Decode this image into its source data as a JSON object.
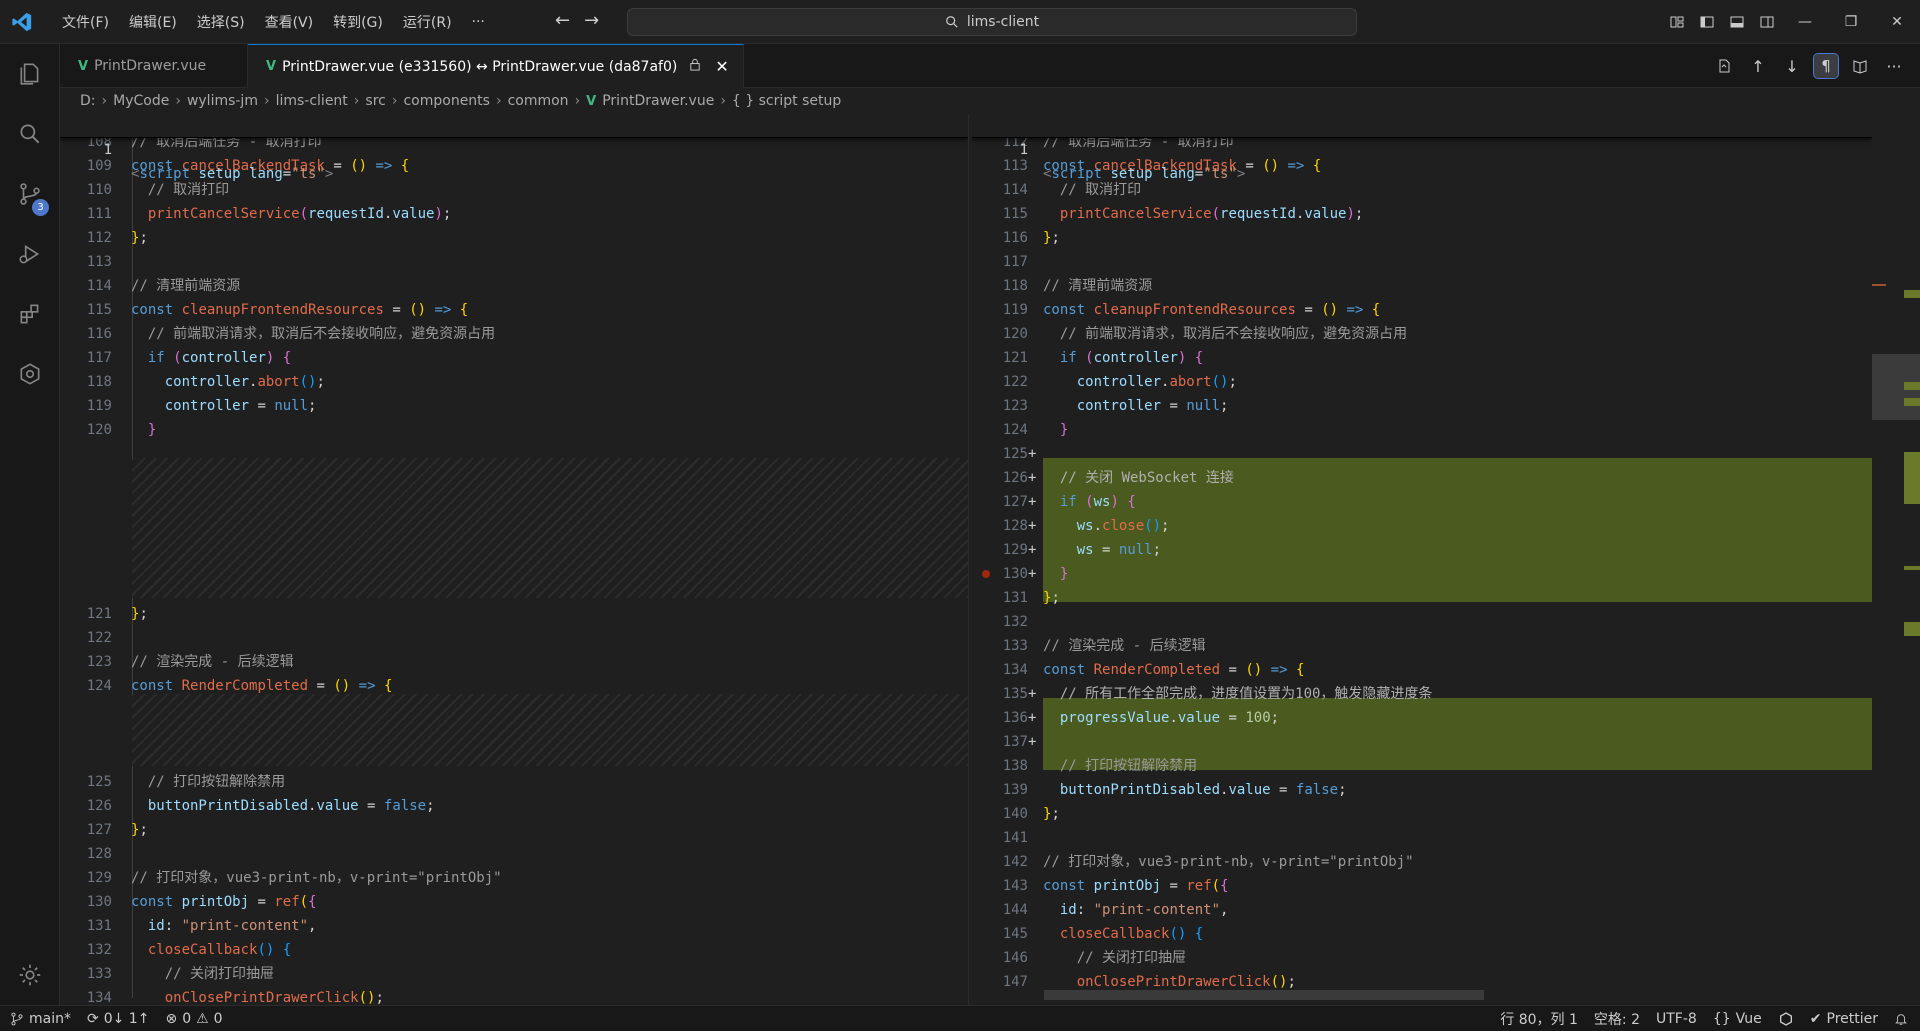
{
  "titlebar": {
    "menu": [
      "文件(F)",
      "编辑(E)",
      "选择(S)",
      "查看(V)",
      "转到(G)",
      "运行(R)",
      "···"
    ],
    "search": "lims-client"
  },
  "activity": {
    "scm_badge": "3"
  },
  "tabs": [
    {
      "label": "PrintDrawer.vue"
    },
    {
      "label": "PrintDrawer.vue (e331560) ↔ PrintDrawer.vue (da87af0)"
    }
  ],
  "breadcrumb": [
    "D:",
    "MyCode",
    "wylims-jm",
    "lims-client",
    "src",
    "components",
    "common",
    "PrintDrawer.vue",
    "{ } script setup"
  ],
  "editor": {
    "sticky_line": "<script setup lang=\"ts\">",
    "sticky_ln": "1",
    "left_numbers": [
      "108",
      "109",
      "110",
      "111",
      "112",
      "113",
      "114",
      "115",
      "116",
      "117",
      "118",
      "119",
      "120",
      "121",
      "122",
      "123",
      "124",
      "125",
      "126",
      "127",
      "128",
      "129",
      "130",
      "131",
      "132",
      "133",
      "134"
    ],
    "right_numbers": [
      "112",
      "113",
      "114",
      "115",
      "116",
      "117",
      "118",
      "119",
      "120",
      "121",
      "122",
      "123",
      "124",
      "125",
      "126",
      "127",
      "128",
      "129",
      "130",
      "131",
      "132",
      "133",
      "134",
      "135",
      "136",
      "137",
      "138",
      "139",
      "140",
      "141",
      "142",
      "143",
      "144",
      "145",
      "146",
      "147"
    ]
  },
  "statusbar": {
    "branch": "main*",
    "sync": "0↓ 1↑",
    "errors": "0",
    "warnings": "0",
    "position": "行 80，列 1",
    "spaces": "空格: 2",
    "encoding": "UTF-8",
    "language": "Vue",
    "prettier": "Prettier"
  }
}
